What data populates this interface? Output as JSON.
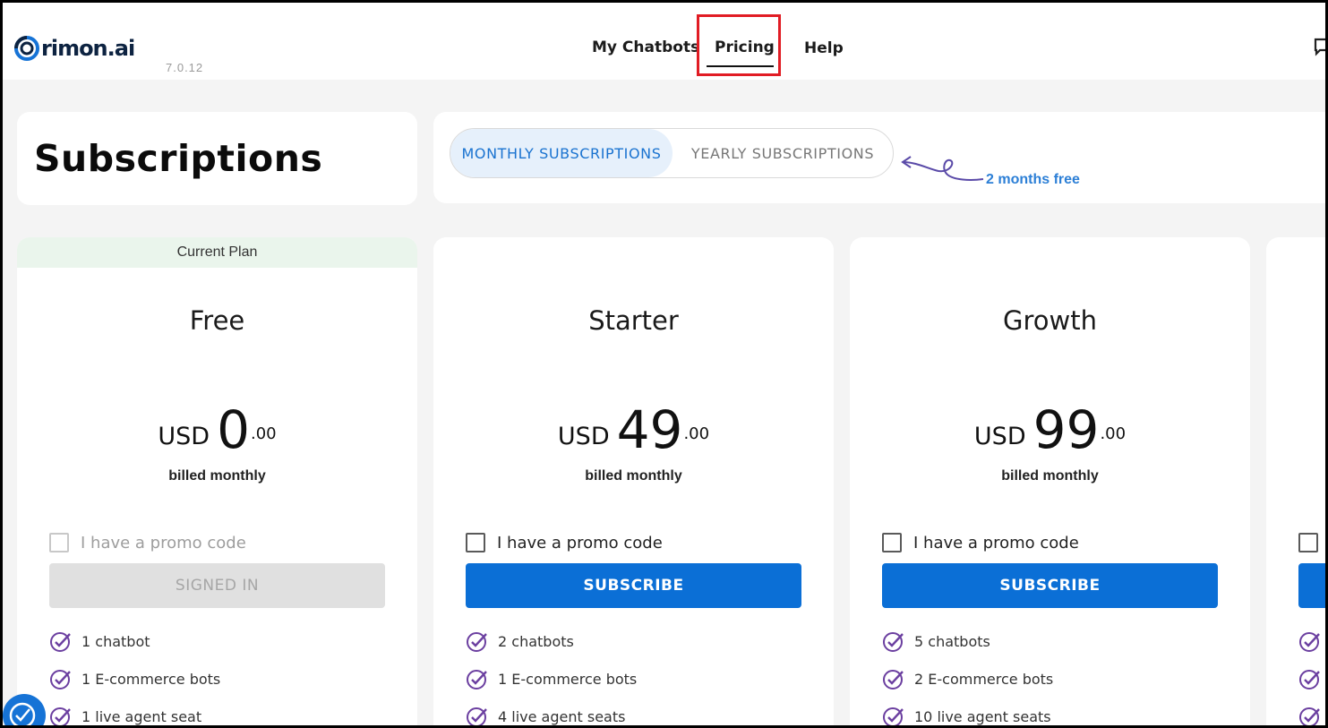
{
  "brand": {
    "name": "rimon.ai",
    "version": "7.0.12"
  },
  "nav": {
    "items": [
      "My Chatbots",
      "Pricing",
      "Help"
    ],
    "active": "Pricing"
  },
  "page": {
    "title": "Subscriptions"
  },
  "toggle": {
    "monthly": "MONTHLY SUBSCRIPTIONS",
    "yearly": "YEARLY SUBSCRIPTIONS",
    "note": "2 months free",
    "selected": "monthly"
  },
  "plans": [
    {
      "badge": "Current Plan",
      "name": "Free",
      "currency": "USD",
      "amount": "0",
      "cents": ".00",
      "billing": "billed monthly",
      "promo_label": "I have a promo code",
      "button": "SIGNED IN",
      "features": [
        "1 chatbot",
        "1 E-commerce bots",
        "1 live agent seat"
      ]
    },
    {
      "name": "Starter",
      "currency": "USD",
      "amount": "49",
      "cents": ".00",
      "billing": "billed monthly",
      "promo_label": "I have a promo code",
      "button": "SUBSCRIBE",
      "features": [
        "2 chatbots",
        "1 E-commerce bots",
        "4 live agent seats"
      ]
    },
    {
      "name": "Growth",
      "currency": "USD",
      "amount": "99",
      "cents": ".00",
      "billing": "billed monthly",
      "promo_label": "I have a promo code",
      "button": "SUBSCRIBE",
      "features": [
        "5 chatbots",
        "2 E-commerce bots",
        "10 live agent seats"
      ]
    }
  ],
  "colors": {
    "primary": "#0b6fd6",
    "check_icon": "#6b3fa0",
    "highlight": "#e11c24",
    "current_plan_bg": "#eaf5ec"
  },
  "icons": [
    "rimon-logo-icon",
    "chat-message-icon",
    "check-circle-icon",
    "accessibility-icon"
  ]
}
